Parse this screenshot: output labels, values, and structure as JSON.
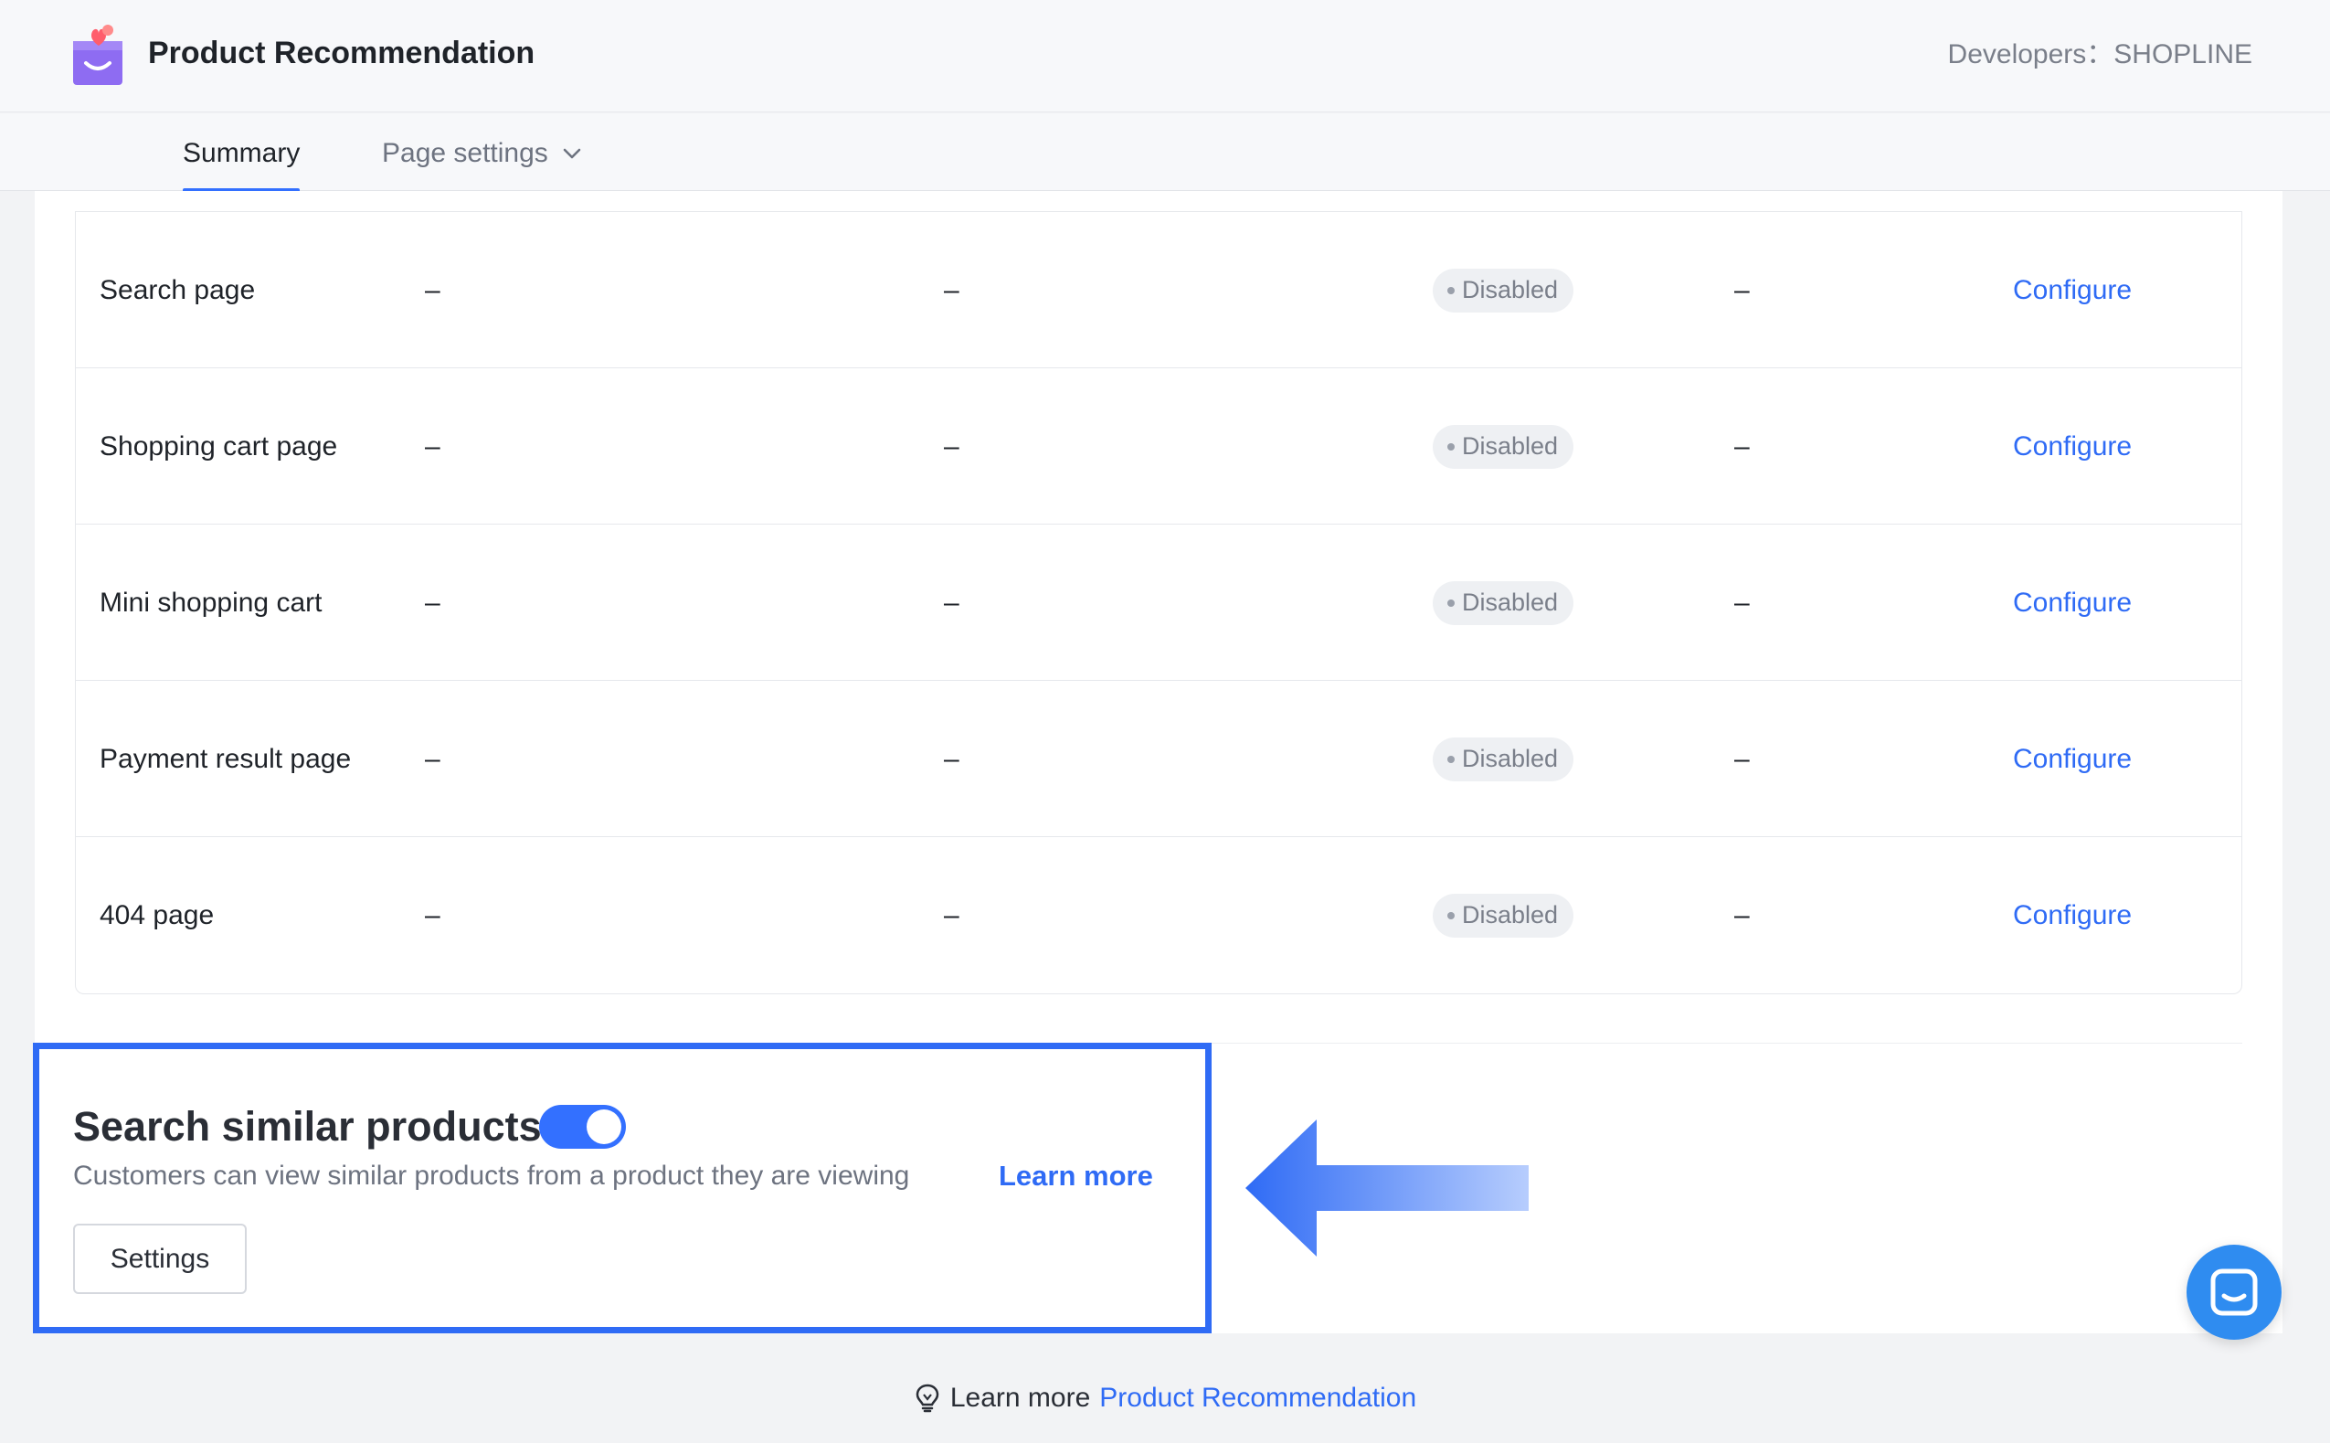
{
  "header": {
    "title": "Product Recommendation",
    "developers": "Developers：SHOPLINE"
  },
  "tabs": {
    "summary": "Summary",
    "page_settings": "Page settings"
  },
  "table": {
    "rows": [
      {
        "name": "Search page",
        "col2": "–",
        "col3": "–",
        "status": "Disabled",
        "col5": "–",
        "action": "Configure"
      },
      {
        "name": "Shopping cart page",
        "col2": "–",
        "col3": "–",
        "status": "Disabled",
        "col5": "–",
        "action": "Configure"
      },
      {
        "name": "Mini shopping cart",
        "col2": "–",
        "col3": "–",
        "status": "Disabled",
        "col5": "–",
        "action": "Configure"
      },
      {
        "name": "Payment result page",
        "col2": "–",
        "col3": "–",
        "status": "Disabled",
        "col5": "–",
        "action": "Configure"
      },
      {
        "name": "404 page",
        "col2": "–",
        "col3": "–",
        "status": "Disabled",
        "col5": "–",
        "action": "Configure"
      }
    ]
  },
  "feature": {
    "title": "Search similar products",
    "toggle_on": true,
    "description": "Customers can view similar products from a product they are viewing",
    "learn_more": "Learn more",
    "settings_button": "Settings"
  },
  "footer": {
    "text": "Learn more",
    "link": "Product Recommendation"
  },
  "colors": {
    "accent": "#3370ff",
    "link": "#2f6bf5",
    "chat": "#2f8cf0"
  },
  "icons": {
    "logo": "shopping-bag-heart-icon",
    "chevron": "chevron-down-icon",
    "arrow": "left-arrow-icon",
    "chat": "chat-icon",
    "bulb": "lightbulb-icon"
  }
}
